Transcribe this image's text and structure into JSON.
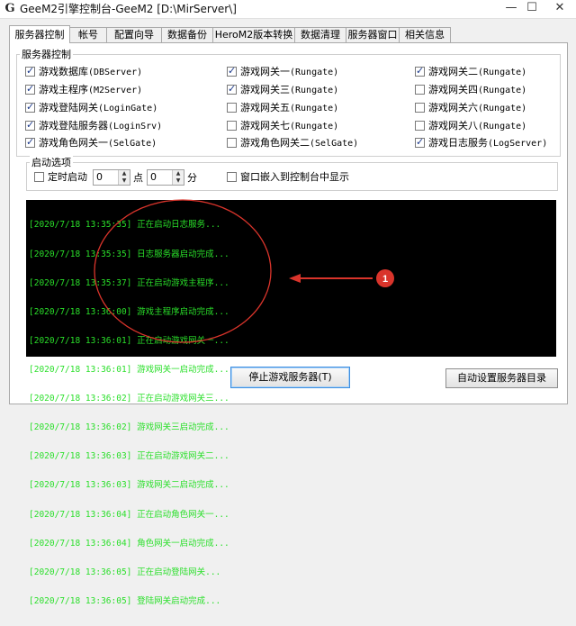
{
  "window": {
    "app_icon": "G",
    "title": "GeeM2引擎控制台-GeeM2 [D:\\MirServer\\]",
    "minimize_icon": "—",
    "maximize_icon": "☐",
    "close_icon": "✕"
  },
  "tabs": [
    {
      "label": "服务器控制"
    },
    {
      "label": "帐号"
    },
    {
      "label": "配置向导"
    },
    {
      "label": "数据备份"
    },
    {
      "label": "HeroM2版本转换"
    },
    {
      "label": "数据清理"
    },
    {
      "label": "服务器窗口"
    },
    {
      "label": "相关信息"
    }
  ],
  "server_control": {
    "group_label": "服务器控制",
    "checkboxes": [
      {
        "label": "游戏数据库",
        "sub": "(DBServer)",
        "checked": true
      },
      {
        "label": "游戏主程序",
        "sub": "(M2Server)",
        "checked": true
      },
      {
        "label": "游戏登陆网关",
        "sub": "(LoginGate)",
        "checked": true
      },
      {
        "label": "游戏登陆服务器",
        "sub": "(LoginSrv)",
        "checked": true
      },
      {
        "label": "游戏角色网关一",
        "sub": "(SelGate)",
        "checked": true
      },
      {
        "label": "游戏网关一",
        "sub": "(Rungate)",
        "checked": true
      },
      {
        "label": "游戏网关三",
        "sub": "(Rungate)",
        "checked": true
      },
      {
        "label": "游戏网关五",
        "sub": "(Rungate)",
        "checked": false
      },
      {
        "label": "游戏网关七",
        "sub": "(Rungate)",
        "checked": false
      },
      {
        "label": "游戏角色网关二",
        "sub": "(SelGate)",
        "checked": false
      },
      {
        "label": "游戏网关二",
        "sub": "(Rungate)",
        "checked": true
      },
      {
        "label": "游戏网关四",
        "sub": "(Rungate)",
        "checked": false
      },
      {
        "label": "游戏网关六",
        "sub": "(Rungate)",
        "checked": false
      },
      {
        "label": "游戏网关八",
        "sub": "(Rungate)",
        "checked": false
      },
      {
        "label": "游戏日志服务",
        "sub": "(LogServer)",
        "checked": true
      }
    ]
  },
  "startup": {
    "group_label": "启动选项",
    "timed_start_label": "定时启动",
    "timed_start_checked": false,
    "hour_value": "0",
    "hour_unit": "点",
    "minute_value": "0",
    "minute_unit": "分",
    "embed_label": "窗口嵌入到控制台中显示",
    "embed_checked": false
  },
  "log": [
    "[2020/7/18 13:35:35] 正在启动日志服务...",
    "[2020/7/18 13:35:35] 日志服务器启动完成...",
    "[2020/7/18 13:35:37] 正在启动游戏主程序...",
    "[2020/7/18 13:36:00] 游戏主程序启动完成...",
    "[2020/7/18 13:36:01] 正在启动游戏网关一...",
    "[2020/7/18 13:36:01] 游戏网关一启动完成...",
    "[2020/7/18 13:36:02] 正在启动游戏网关三...",
    "[2020/7/18 13:36:02] 游戏网关三启动完成...",
    "[2020/7/18 13:36:03] 正在启动游戏网关二...",
    "[2020/7/18 13:36:03] 游戏网关二启动完成...",
    "[2020/7/18 13:36:04] 正在启动角色网关一...",
    "[2020/7/18 13:36:04] 角色网关一启动完成...",
    "[2020/7/18 13:36:05] 正在启动登陆网关...",
    "[2020/7/18 13:36:05] 登陆网关启动完成..."
  ],
  "annotation": {
    "number": "1"
  },
  "buttons": {
    "stop": "停止游戏服务器(T)",
    "auto_dir": "自动设置服务器目录"
  },
  "colors": {
    "log_text": "#2adf2a",
    "annotation": "#d9342b"
  }
}
